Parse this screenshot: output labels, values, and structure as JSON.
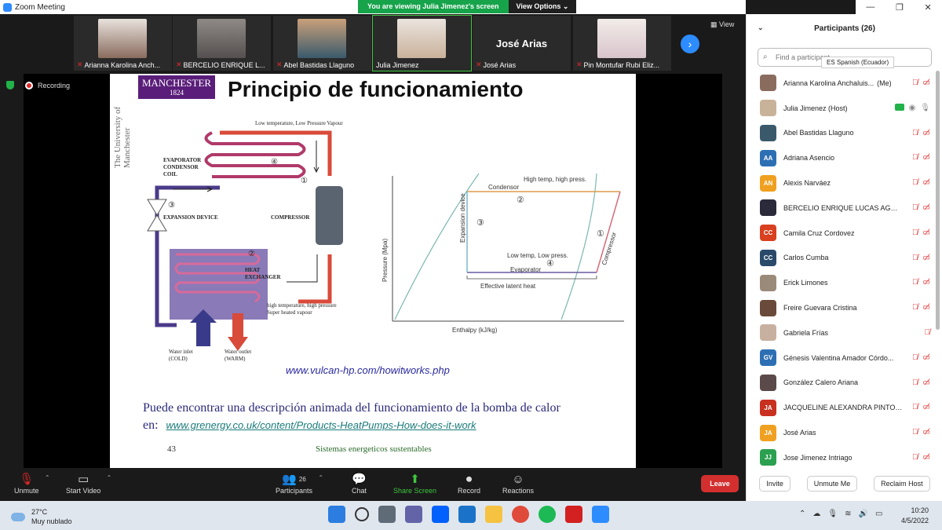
{
  "window": {
    "title": "Zoom Meeting"
  },
  "banner": {
    "viewing": "You are viewing Julia Jimenez's screen",
    "view_options": "View Options ⌄"
  },
  "window_controls": {
    "minimize": "—",
    "maximize": "❐",
    "close": "✕"
  },
  "strip": {
    "view_label": "View",
    "tiles": [
      {
        "name": "Arianna Karolina Anch...",
        "color": "#8a6c5e",
        "muted": true
      },
      {
        "name": "BERCELIO ENRIQUE L...",
        "color": "#55504f",
        "muted": true
      },
      {
        "name": "Abel Bastidas Llaguno",
        "color": "#3a5a6c",
        "muted": true
      },
      {
        "name": "Julia Jimenez",
        "color": "#c9b29a",
        "muted": false,
        "active": true
      },
      {
        "name": "José Arias",
        "big_name": "José Arias",
        "muted": true
      },
      {
        "name": "Pin Montufar Rubi Eliz...",
        "color": "#d8c4cc",
        "muted": true
      }
    ]
  },
  "recording": {
    "label": "Recording"
  },
  "slide": {
    "logo_text": "MANCHESTER",
    "logo_year": "1824",
    "university": "The University of Manchester",
    "title": "Principio de funcionamiento",
    "labels": {
      "low_temp": "Low temperature, Low Pressure Vapour",
      "evaporator": "EVAPORATOR",
      "condensor": "CONDENSOR",
      "coil": "COIL",
      "expansion": "EXPANSION DEVICE",
      "compressor": "COMPRESSOR",
      "heat": "HEAT",
      "exchanger": "EXCHANGER",
      "high_temp": "high temperature, high pressure",
      "superheated": "Super heated vapour",
      "water_in": "Water inlet",
      "cold": "(COLD)",
      "water_out": "Water outlet",
      "warm": "(WARM)",
      "n1": "①",
      "n2": "②",
      "n3": "③",
      "n4": "④"
    },
    "chart": {
      "high_temp": "High temp, high press.",
      "condensor": "Condensor",
      "expansion": "Expansion device",
      "compressor": "Compressor",
      "low_temp": "Low temp, Low press.",
      "evaporator": "Evaporator",
      "latent": "Effective latent heat",
      "ylabel": "Pressure (Mpa)",
      "xlabel": "Enthalpy (kJ/kg)"
    },
    "url1": "www.vulcan-hp.com/howitworks.php",
    "desc": "Puede encontrar una descripción animada del funcionamiento de la bomba de calor en:",
    "url2": "www.grenergy.co.uk/content/Products-HeatPumps-How-does-it-work",
    "page": "43",
    "footer": "Sistemas energeticos sustentables"
  },
  "toolbar": {
    "unmute": "Unmute",
    "start_video": "Start Video",
    "participants": "Participants",
    "participants_count": "26",
    "chat": "Chat",
    "share": "Share Screen",
    "record": "Record",
    "reactions": "Reactions",
    "leave": "Leave"
  },
  "panel": {
    "title": "Participants (26)",
    "search_placeholder": "Find a participant",
    "lang_tip": "ES Spanish (Ecuador)",
    "participants": [
      {
        "name": "Arianna Karolina Anchaluis...",
        "suffix": "(Me)",
        "initials": "",
        "color": "#8a6c5e"
      },
      {
        "name": "Julia Jimenez (Host)",
        "initials": "",
        "color": "#c9b29a",
        "host": true
      },
      {
        "name": "Abel Bastidas Llaguno",
        "initials": "",
        "color": "#3a5a6c"
      },
      {
        "name": "Adriana Asencio",
        "initials": "AA",
        "color": "#2d6fb3"
      },
      {
        "name": "Alexis Narváez",
        "initials": "AN",
        "color": "#f0a020"
      },
      {
        "name": "BERCELIO ENRIQUE LUCAS AGUI...",
        "initials": "",
        "color": "#2a2a3a"
      },
      {
        "name": "Camila Cruz Cordovez",
        "initials": "CC",
        "color": "#d84020"
      },
      {
        "name": "Carlos Cumba",
        "initials": "CC",
        "color": "#2a4a6a"
      },
      {
        "name": "Erick Limones",
        "initials": "",
        "color": "#9a8a7a"
      },
      {
        "name": "Freire Guevara Cristina",
        "initials": "",
        "color": "#6a4a3a"
      },
      {
        "name": "Gabriela Frías",
        "initials": "",
        "color": "#c8b0a0",
        "no_video_icon": true
      },
      {
        "name": "Génesis Valentina Amador Córdo...",
        "initials": "GV",
        "color": "#2d6fb3"
      },
      {
        "name": "González Calero Ariana",
        "initials": "",
        "color": "#5a4a4a"
      },
      {
        "name": "JACQUELINE ALEXANDRA PINTO RO...",
        "initials": "JA",
        "color": "#c83020"
      },
      {
        "name": "José Arias",
        "initials": "JA",
        "color": "#f0a020"
      },
      {
        "name": "Jose Jimenez Intriago",
        "initials": "JJ",
        "color": "#2aa050"
      }
    ],
    "invite": "Invite",
    "unmute_me": "Unmute Me",
    "reclaim": "Reclaim Host"
  },
  "taskbar": {
    "temp": "27°C",
    "weather": "Muy nublado",
    "time": "10:20",
    "date": "4/5/2022",
    "apps": [
      {
        "name": "windows",
        "color": "#2b7de0"
      },
      {
        "name": "search",
        "color": "#dfe6ee"
      },
      {
        "name": "task-view",
        "color": "#606b78"
      },
      {
        "name": "teams",
        "color": "#6264a7"
      },
      {
        "name": "dropbox",
        "color": "#0061fe"
      },
      {
        "name": "mail",
        "color": "#1a73c8"
      },
      {
        "name": "explorer",
        "color": "#f5c242"
      },
      {
        "name": "chrome",
        "color": "#e04a3a"
      },
      {
        "name": "spotify",
        "color": "#1db954"
      },
      {
        "name": "acrobat",
        "color": "#d32020"
      },
      {
        "name": "zoom",
        "color": "#2d8cff"
      }
    ]
  }
}
